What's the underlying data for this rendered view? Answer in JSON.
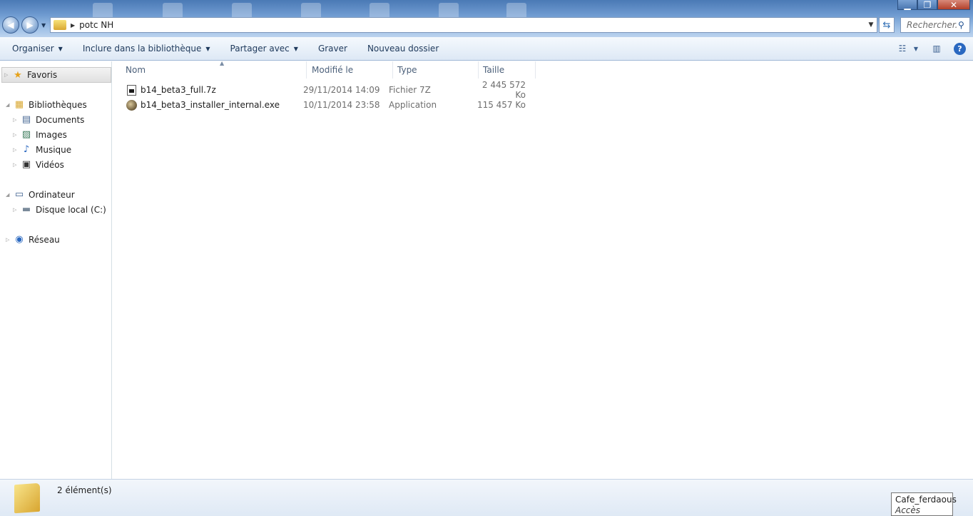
{
  "window": {
    "minimize": "▁",
    "maximize": "❐",
    "close": "✕"
  },
  "address": {
    "path": "potc NH"
  },
  "search": {
    "placeholder": "Rechercher..."
  },
  "toolbar": {
    "organiser": "Organiser",
    "include": "Inclure dans la bibliothèque",
    "share": "Partager avec",
    "burn": "Graver",
    "new_folder": "Nouveau dossier"
  },
  "nav": {
    "favorites": "Favoris",
    "libraries": "Bibliothèques",
    "documents": "Documents",
    "images": "Images",
    "music": "Musique",
    "videos": "Vidéos",
    "computer": "Ordinateur",
    "local_disk": "Disque local (C:)",
    "network": "Réseau"
  },
  "columns": {
    "name": "Nom",
    "modified": "Modifié le",
    "type": "Type",
    "size": "Taille"
  },
  "files": [
    {
      "name": "b14_beta3_full.7z",
      "modified": "29/11/2014 14:09",
      "type": "Fichier 7Z",
      "size": "2 445 572 Ko",
      "icon": "archive-icon"
    },
    {
      "name": "b14_beta3_installer_internal.exe",
      "modified": "10/11/2014 23:58",
      "type": "Application",
      "size": "115 457 Ko",
      "icon": "application-icon"
    }
  ],
  "status": {
    "count": "2 élément(s)"
  },
  "tooltip": {
    "network_name": "Cafe_ferdaous",
    "network_status": "Accès Internet"
  },
  "colors": {
    "accent": "#2a68c0",
    "text": "#1e395b",
    "muted": "#6d6d6d"
  }
}
